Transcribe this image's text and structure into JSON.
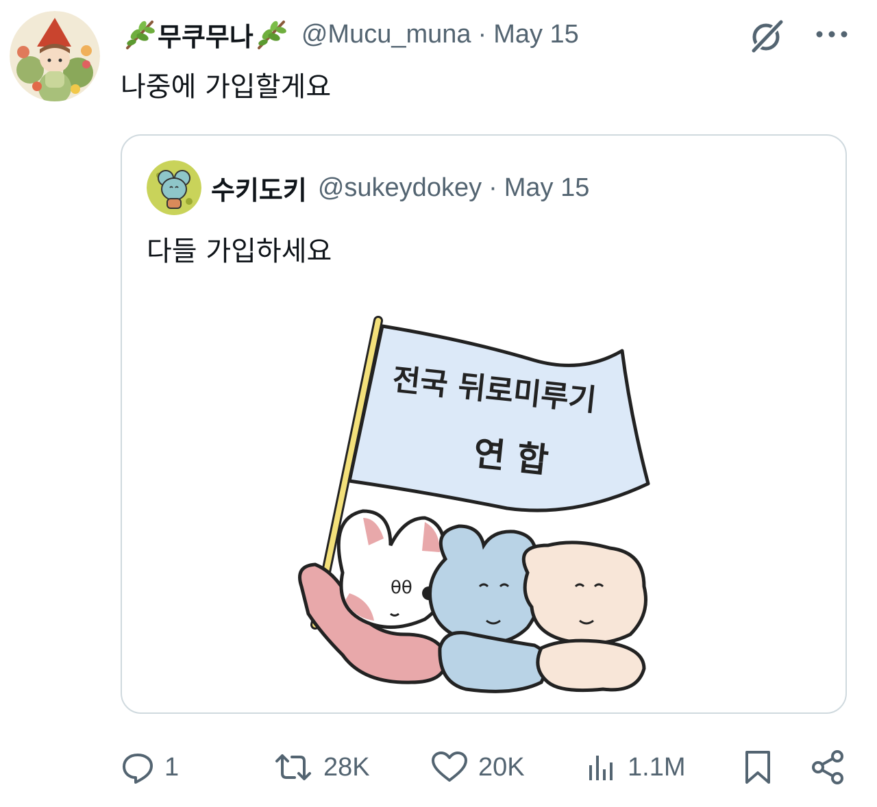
{
  "tweet": {
    "display_name": "무쿠무나",
    "handle": "@Mucu_muna",
    "separator": "·",
    "date": "May 15",
    "text": "나중에 가입할게요",
    "name_emoji": "herb-sprig-icon"
  },
  "quoted": {
    "display_name": "수키도키",
    "handle": "@sukeydokey",
    "separator": "·",
    "date": "May 15",
    "text": "다들 가입하세요",
    "image": {
      "flag_line1": "전국 뒤로미루기",
      "flag_line2": "연 합"
    }
  },
  "actions": {
    "reply_count": "1",
    "retweet_count": "28K",
    "like_count": "20K",
    "views_count": "1.1M"
  },
  "icons": {
    "reply": "reply-icon",
    "retweet": "retweet-icon",
    "like": "heart-icon",
    "views": "views-icon",
    "bookmark": "bookmark-icon",
    "share": "share-icon",
    "grok": "grok-icon",
    "more": "more-icon"
  },
  "colors": {
    "text": "#0f1419",
    "secondary": "#536471",
    "border": "#cfd9de",
    "flag": "#dce9f8",
    "pole": "#f3e07a"
  }
}
